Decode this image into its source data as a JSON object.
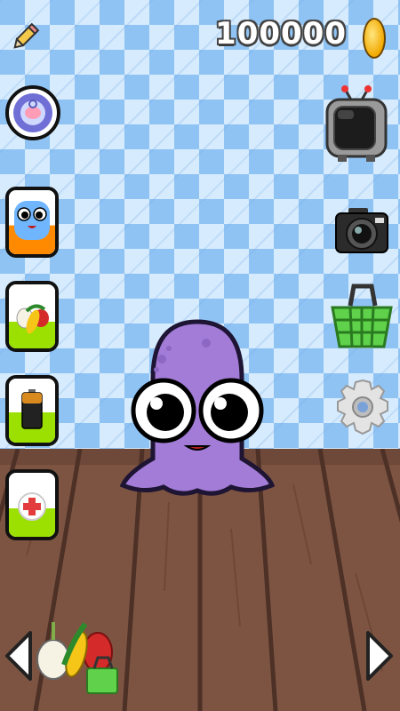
{
  "hud": {
    "coins": "100000",
    "edit_icon": "pencil-icon",
    "coin_icon": "gold-coin-icon"
  },
  "left_menu": [
    {
      "name": "pacifier-button",
      "icon": "pacifier-icon"
    },
    {
      "name": "mood-meter",
      "icon": "moy-face-icon",
      "level": 0.45,
      "color": "#ff8a00"
    },
    {
      "name": "food-meter",
      "icon": "vegetables-icon",
      "level": 0.4,
      "color": "#9be000"
    },
    {
      "name": "energy-meter",
      "icon": "battery-icon",
      "level": 0.45,
      "color": "#9be000"
    },
    {
      "name": "health-meter",
      "icon": "medical-cross-icon",
      "level": 0.4,
      "color": "#9be000"
    }
  ],
  "right_menu": [
    {
      "name": "tv-button",
      "icon": "tv-icon"
    },
    {
      "name": "camera-button",
      "icon": "camera-icon"
    },
    {
      "name": "shop-basket-button",
      "icon": "basket-icon"
    },
    {
      "name": "settings-button",
      "icon": "gear-icon"
    }
  ],
  "bottom": {
    "left_arrow": "arrow-left-icon",
    "right_arrow": "arrow-right-icon",
    "room_icon": "kitchen-food-icon"
  },
  "colors": {
    "wall_light": "#d6ebfd",
    "wall_dark": "#8fc3f4",
    "floor": "#7a5140",
    "pet": "#a27cd6"
  }
}
